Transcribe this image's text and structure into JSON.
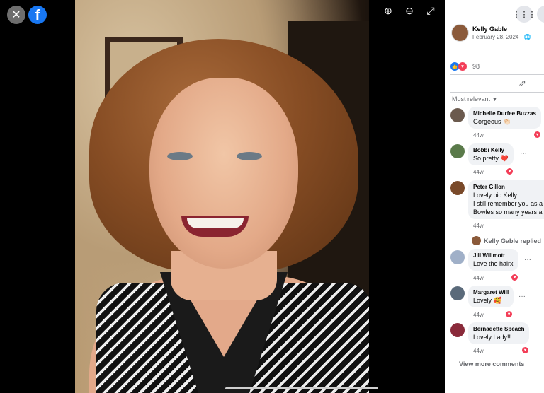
{
  "viewer": {
    "close_icon": "close-icon",
    "logo_icon": "facebook-logo",
    "logo_letter": "f",
    "tools": [
      {
        "name": "zoom-in-icon",
        "glyph": "⊕"
      },
      {
        "name": "zoom-out-icon",
        "glyph": "⊖"
      },
      {
        "name": "fullscreen-icon",
        "glyph": "⤢"
      }
    ]
  },
  "panel": {
    "menu_icon": "grid-menu-icon",
    "author": "Kelly Gable",
    "date": "February 28, 2024 ·",
    "reaction_count": "98",
    "sort_label": "Most relevant",
    "view_more": "View more comments",
    "replied_text": "Kelly Gable replied"
  },
  "comments": [
    {
      "name": "Michelle Durfee Buzzas",
      "text": "Gorgeous 👏🏻",
      "time": "44w",
      "avatar_color": "#6b5a4e"
    },
    {
      "name": "Bobbi Kelly",
      "text": "So pretty ❤️",
      "time": "44w",
      "avatar_color": "#5a7a4a"
    },
    {
      "name": "Peter Gillon",
      "text1": "Lovely pic Kelly",
      "text2": "I still remember you as a",
      "text3": "Bowles so many years a",
      "time": "44w",
      "avatar_color": "#7a4a2a"
    },
    {
      "name": "Jill Willmott",
      "text": "Love the hairx",
      "time": "44w",
      "avatar_color": "#a0b0c8"
    },
    {
      "name": "Margaret Will",
      "text": "Lovely 🥰",
      "time": "44w",
      "avatar_color": "#5a6a7a"
    },
    {
      "name": "Bernadette Speach",
      "text": "Lovely Lady!!",
      "time": "44w",
      "avatar_color": "#8a2a3a"
    }
  ],
  "colors": {
    "brand": "#1877f2",
    "love": "#f33e58",
    "muted": "#65676b"
  }
}
